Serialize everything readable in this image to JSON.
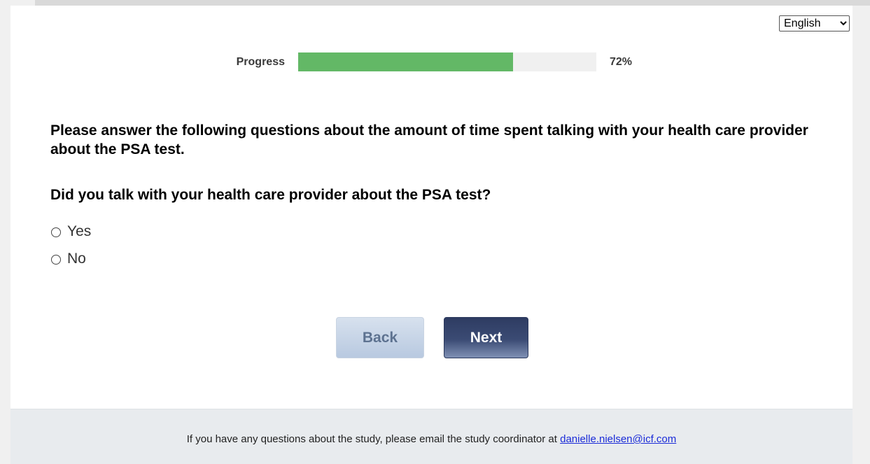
{
  "language": {
    "selected": "English"
  },
  "progress": {
    "label": "Progress",
    "percent_text": "72%",
    "fraction": 0.72
  },
  "survey": {
    "intro": "Please answer the following questions about the amount of time spent talking with your health care provider about the PSA test.",
    "question": "Did you talk with your health care provider about the PSA test?",
    "options": [
      {
        "label": "Yes"
      },
      {
        "label": "No"
      }
    ]
  },
  "buttons": {
    "back_label": "Back",
    "next_label": "Next"
  },
  "footer": {
    "text": "If you have any questions about the study, please email the study coordinator at ",
    "email": "danielle.nielsen@icf.com"
  },
  "colors": {
    "progress_fill": "#63b866",
    "progress_track": "#f0f0f0",
    "next_button": "#2e3c62",
    "back_button": "#c6d4e8",
    "footer_link": "#1a2bd8"
  }
}
